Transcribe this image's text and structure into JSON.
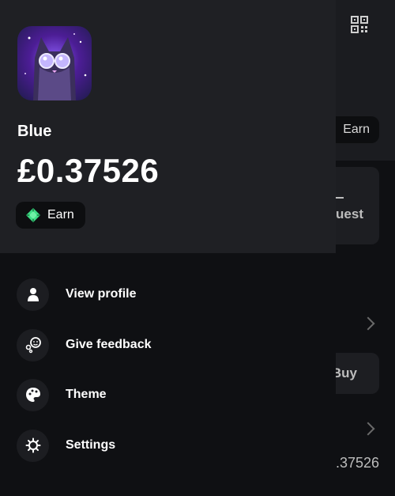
{
  "drawer": {
    "username": "Blue",
    "balance": "£0.37526",
    "earn_label": "Earn",
    "menu": [
      {
        "label": "View profile",
        "icon": "person-icon"
      },
      {
        "label": "Give feedback",
        "icon": "feedback-icon"
      },
      {
        "label": "Theme",
        "icon": "palette-icon"
      },
      {
        "label": "Settings",
        "icon": "gear-icon"
      }
    ]
  },
  "background": {
    "earn_label": "Earn",
    "card_text": "uest",
    "buy_label": "Buy",
    "amount_text": ".37526"
  },
  "colors": {
    "accent_green": "#3ddc84",
    "drawer_header": "#1f2024",
    "drawer_body": "#0f1013"
  }
}
